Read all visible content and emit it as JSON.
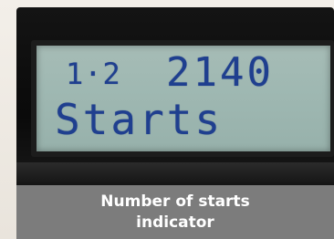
{
  "display": {
    "mode_indicator": "1·2",
    "start_count": "2140",
    "label": "Starts"
  },
  "caption": {
    "text": "Number of starts indicator"
  },
  "colors": {
    "lcd_background": "#a3bab4",
    "lcd_segment": "#1f3f8f",
    "caption_band": "#7c7c7c",
    "caption_text": "#ffffff"
  }
}
